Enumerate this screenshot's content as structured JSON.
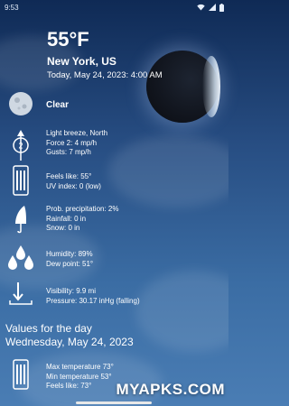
{
  "status_bar": {
    "time": "9:53",
    "icons": [
      "wifi-icon",
      "cell-signal-icon",
      "battery-icon"
    ]
  },
  "header": {
    "temperature": "55°F",
    "location": "New York, US",
    "datetime": "Today, May 24, 2023: 4:00 AM"
  },
  "condition": {
    "label": "Clear",
    "icon": "moon-phase-icon"
  },
  "wind": {
    "icon": "wind-direction-icon",
    "direction_value": "2",
    "lines": [
      "Light breeze, North",
      "Force 2: 4 mp/h",
      "Gusts: 7 mp/h"
    ]
  },
  "feels": {
    "icon": "thermometer-icon",
    "lines": [
      "Feels like: 55°",
      "UV index: 0 (low)"
    ]
  },
  "precip": {
    "icon": "umbrella-icon",
    "lines": [
      "Prob. precipitation: 2%",
      "Rainfall: 0 in",
      "Snow: 0 in"
    ]
  },
  "humidity": {
    "icon": "droplets-icon",
    "lines": [
      "Humidity: 89%",
      "Dew point: 51°"
    ]
  },
  "visibility": {
    "icon": "pressure-arrow-icon",
    "lines": [
      "Visibility: 9.9 mi",
      "Pressure: 30.17 inHg (falling)"
    ]
  },
  "day_section": {
    "title": "Values for the day",
    "date": "Wednesday, May 24, 2023",
    "icon": "thermometer-icon",
    "lines": [
      "Max temperature 73°",
      "Min temperature 53°",
      "Feels like: 73°"
    ]
  },
  "watermark": "MYAPKS.COM",
  "colors": {
    "background_top": "#0f2a55",
    "background_bottom": "#4a7db4",
    "text": "#ffffff"
  }
}
